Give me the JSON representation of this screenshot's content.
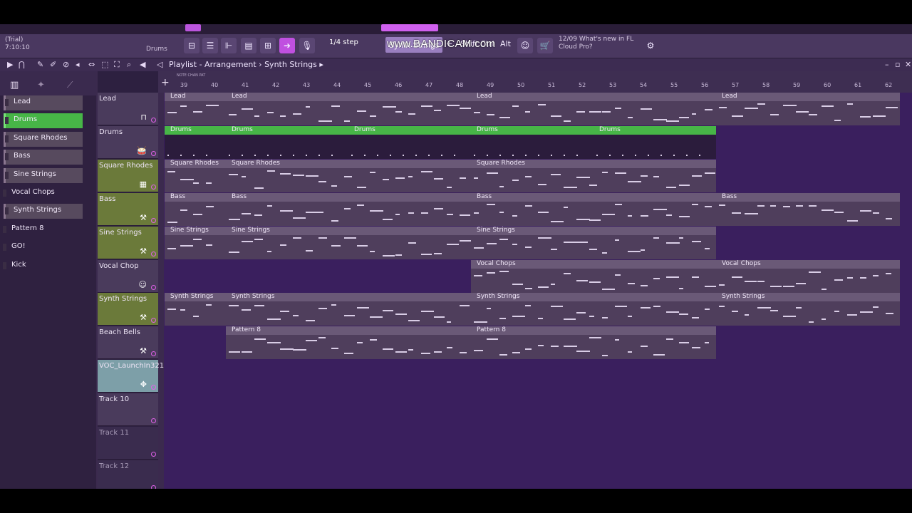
{
  "app": {
    "trial": "(Trial)",
    "time": "7:10:10",
    "channel": "Drums",
    "watermark": "www.BANDICAM.com"
  },
  "toolbar": {
    "step": "1/4 step",
    "pattern": "Synth Strings",
    "plus": "+",
    "keys": [
      "Shift",
      "Ctrl",
      "Alt"
    ],
    "news_date": "12/09",
    "news_text": "What's new in FL",
    "news_text2": "Cloud Pro?"
  },
  "titlebar": {
    "path": "Playlist - Arrangement",
    "sep": "›",
    "pattern": "Synth Strings",
    "arrow": "▸"
  },
  "sidebar": {
    "items": [
      {
        "label": "Lead",
        "style": "clip"
      },
      {
        "label": "Drums",
        "style": "active"
      },
      {
        "label": "Square Rhodes",
        "style": "clip"
      },
      {
        "label": "Bass",
        "style": "clip"
      },
      {
        "label": "Sine Strings",
        "style": "clip"
      },
      {
        "label": "Vocal Chops",
        "style": "plain"
      },
      {
        "label": "Synth Strings",
        "style": "clip"
      },
      {
        "label": "Pattern 8",
        "style": "plain"
      },
      {
        "label": "GO!",
        "style": "plain"
      },
      {
        "label": "Kick",
        "style": "plain"
      }
    ]
  },
  "ruler": {
    "bars": [
      "39",
      "40",
      "41",
      "42",
      "43",
      "44",
      "45",
      "46",
      "47",
      "48",
      "49",
      "50",
      "51",
      "52",
      "53",
      "54",
      "55",
      "56",
      "57",
      "58",
      "59",
      "60",
      "61",
      "62"
    ]
  },
  "tracks": [
    {
      "name": "Lead",
      "style": "normal",
      "icon": "⊓"
    },
    {
      "name": "Drums",
      "style": "normal",
      "icon": "🥁"
    },
    {
      "name": "Square Rhodes",
      "style": "olive",
      "icon": "▦"
    },
    {
      "name": "Bass",
      "style": "olive",
      "icon": "⚒"
    },
    {
      "name": "Sine Strings",
      "style": "olive",
      "icon": "⚒"
    },
    {
      "name": "Vocal Chop",
      "style": "normal",
      "icon": "☺"
    },
    {
      "name": "Synth Strings",
      "style": "olive",
      "icon": "⚒"
    },
    {
      "name": "Beach Bells",
      "style": "normal",
      "icon": "⚒"
    },
    {
      "name": "VOC_LaunchIn321",
      "style": "voc",
      "icon": "✥"
    },
    {
      "name": "Track 10",
      "style": "normal",
      "icon": ""
    },
    {
      "name": "Track 11",
      "style": "dim",
      "icon": ""
    },
    {
      "name": "Track 12",
      "style": "dim",
      "icon": ""
    }
  ],
  "clips": [
    {
      "track": 0,
      "label": "Lead",
      "start": 39,
      "end": 41
    },
    {
      "track": 0,
      "label": "Lead",
      "start": 41,
      "end": 49
    },
    {
      "track": 0,
      "label": "Lead",
      "start": 49,
      "end": 57
    },
    {
      "track": 0,
      "label": "Lead",
      "start": 57,
      "end": 63
    },
    {
      "track": 1,
      "label": "Drums",
      "start": 39,
      "end": 41,
      "green": true
    },
    {
      "track": 1,
      "label": "Drums",
      "start": 41,
      "end": 45,
      "green": true
    },
    {
      "track": 1,
      "label": "Drums",
      "start": 45,
      "end": 49,
      "green": true
    },
    {
      "track": 1,
      "label": "Drums",
      "start": 49,
      "end": 53,
      "green": true
    },
    {
      "track": 1,
      "label": "Drums",
      "start": 53,
      "end": 57,
      "green": true
    },
    {
      "track": 2,
      "label": "Square Rhodes",
      "start": 39,
      "end": 41
    },
    {
      "track": 2,
      "label": "Square Rhodes",
      "start": 41,
      "end": 49
    },
    {
      "track": 2,
      "label": "Square Rhodes",
      "start": 49,
      "end": 57
    },
    {
      "track": 3,
      "label": "Bass",
      "start": 39,
      "end": 41
    },
    {
      "track": 3,
      "label": "Bass",
      "start": 41,
      "end": 49
    },
    {
      "track": 3,
      "label": "Bass",
      "start": 49,
      "end": 57
    },
    {
      "track": 3,
      "label": "Bass",
      "start": 57,
      "end": 63
    },
    {
      "track": 4,
      "label": "Sine Strings",
      "start": 39,
      "end": 41
    },
    {
      "track": 4,
      "label": "Sine Strings",
      "start": 41,
      "end": 49
    },
    {
      "track": 4,
      "label": "Sine Strings",
      "start": 49,
      "end": 57
    },
    {
      "track": 5,
      "label": "Vocal Chops",
      "start": 49,
      "end": 57
    },
    {
      "track": 5,
      "label": "Vocal Chops",
      "start": 57,
      "end": 63
    },
    {
      "track": 6,
      "label": "Synth Strings",
      "start": 39,
      "end": 41
    },
    {
      "track": 6,
      "label": "Synth Strings",
      "start": 41,
      "end": 49
    },
    {
      "track": 6,
      "label": "Synth Strings",
      "start": 49,
      "end": 57
    },
    {
      "track": 6,
      "label": "Synth Strings",
      "start": 57,
      "end": 63
    },
    {
      "track": 7,
      "label": "Pattern 8",
      "start": 41,
      "end": 49
    },
    {
      "track": 7,
      "label": "Pattern 8",
      "start": 49,
      "end": 57
    }
  ],
  "colors": {
    "accent": "#c050e0",
    "clip_green": "#47b547",
    "grid": "#3a1f5e"
  }
}
